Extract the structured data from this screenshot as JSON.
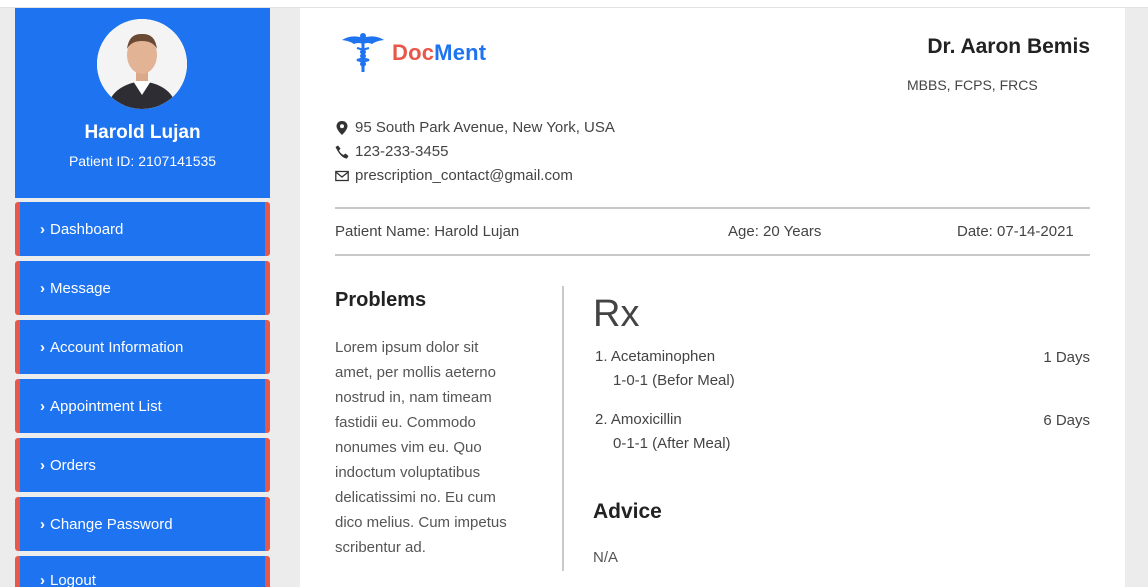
{
  "patient": {
    "name": "Harold Lujan",
    "id_label": "Patient ID: 2107141535"
  },
  "sidebar": {
    "items": [
      {
        "label": "Dashboard"
      },
      {
        "label": "Message"
      },
      {
        "label": "Account Information"
      },
      {
        "label": "Appointment List"
      },
      {
        "label": "Orders"
      },
      {
        "label": "Change Password"
      },
      {
        "label": "Logout"
      }
    ]
  },
  "prescription": {
    "logo": {
      "part1": "Doc",
      "part2": "Ment"
    },
    "doctor_name": "Dr. Aaron Bemis",
    "doctor_degrees": "MBBS, FCPS, FRCS",
    "address": "95 South Park Avenue, New York, USA",
    "phone": "123-233-3455",
    "email": "prescription_contact@gmail.com",
    "patient_name": "Patient Name: Harold Lujan",
    "age": "Age: 20 Years",
    "date": "Date: 07-14-2021",
    "problems_title": "Problems",
    "problems_text": "Lorem ipsum dolor sit amet, per mollis aeterno nostrud in, nam timeam fastidii eu. Commodo nonumes vim eu. Quo indoctum voluptatibus delicatissimi no. Eu cum dico melius. Cum impetus scribentur ad.",
    "rx_symbol": "Rx",
    "medicines": [
      {
        "name": "1. Acetaminophen",
        "dosage": "1-0-1 (Befor Meal)",
        "duration": "1 Days"
      },
      {
        "name": "2. Amoxicillin",
        "dosage": "0-1-1 (After Meal)",
        "duration": "6 Days"
      }
    ],
    "advice_title": "Advice",
    "advice_text": "N/A"
  },
  "colors": {
    "primary": "#1e73f0",
    "accent": "#e8584a",
    "background": "#ececec"
  },
  "icons": [
    "map-marker-icon",
    "phone-icon",
    "envelope-icon",
    "chevron-right-icon",
    "caduceus-icon"
  ]
}
